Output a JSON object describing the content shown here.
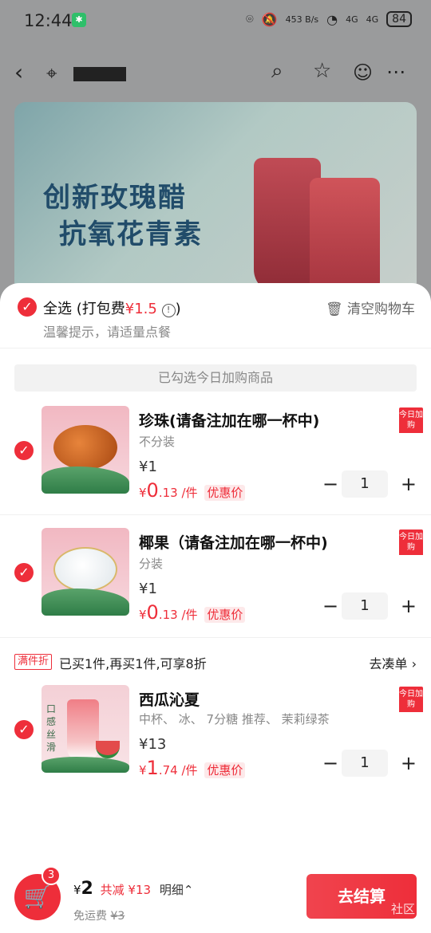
{
  "status_bar": {
    "time": "12:44",
    "network_speed": "453 B/s",
    "signal1": "4G",
    "signal2": "4G",
    "battery": "84"
  },
  "banner": {
    "line1": "创新玫瑰醋",
    "line2": "抗氧花青素"
  },
  "sheet": {
    "select_all_label": "全选",
    "packing_fee_prefix": "(打包费",
    "packing_fee": "¥1.5",
    "packing_fee_suffix": ")",
    "tip": "温馨提示，请适量点餐",
    "clear_cart": "清空购物车",
    "added_today_label": "已勾选今日加购商品"
  },
  "items": [
    {
      "name": "珍珠(请备注加在哪一杯中)",
      "spec": "不分装",
      "orig_price": "¥1",
      "sale_symbol": "¥",
      "sale_int": "0",
      "sale_dec": ".13",
      "sale_unit": "/件",
      "sale_tag": "优惠价",
      "qty": "1",
      "badge": "今日加购"
    },
    {
      "name": "椰果（请备注加在哪一杯中)",
      "spec": "分装",
      "orig_price": "¥1",
      "sale_symbol": "¥",
      "sale_int": "0",
      "sale_dec": ".13",
      "sale_unit": "/件",
      "sale_tag": "优惠价",
      "qty": "1",
      "badge": "今日加购"
    },
    {
      "name": "西瓜沁夏",
      "spec": "中杯、 冰、 7分糖 推荐、 茉莉绿茶",
      "orig_price": "¥13",
      "sale_symbol": "¥",
      "sale_int": "1",
      "sale_dec": ".74",
      "sale_unit": "/件",
      "sale_tag": "优惠价",
      "qty": "1",
      "badge": "今日加购",
      "thumb_text": "口感丝滑"
    }
  ],
  "promo": {
    "tag": "满件折",
    "text": "已买1件,再买1件,可享8折",
    "link": "去凑单 ›"
  },
  "bottom": {
    "cart_count": "3",
    "currency": "¥",
    "total": "2",
    "discount": "共减 ¥13",
    "detail": "明细⌃",
    "freight_label": "免运费",
    "freight_orig": "¥3",
    "checkout": "去结算",
    "watermark": "社区"
  },
  "colors": {
    "accent": "#ee2e3a"
  }
}
